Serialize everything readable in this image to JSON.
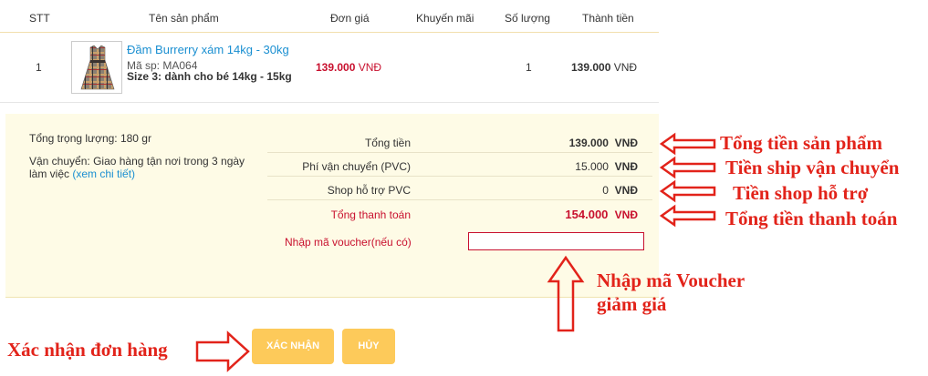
{
  "table": {
    "headers": {
      "stt": "STT",
      "name": "Tên sản phẩm",
      "unit_price": "Đơn giá",
      "promo": "Khuyến mãi",
      "qty": "Số lượng",
      "subtotal": "Thành tiền"
    },
    "rows": [
      {
        "stt": "1",
        "name": "Đầm Burrerry xám 14kg - 30kg",
        "sku": "Mã sp: MA064",
        "size_label": "Size 3:",
        "size_value": "dành cho bé 14kg - 15kg",
        "unit_price": "139.000",
        "currency": "VNĐ",
        "qty": "1",
        "subtotal": "139.000"
      }
    ]
  },
  "summary": {
    "weight": "Tổng trọng lượng: 180 gr",
    "shipping_label": "Vận chuyển:",
    "shipping_text_1": "Giao hàng tận nơi trong 3 ngày",
    "shipping_text_2": "làm việc",
    "shipping_link": "(xem chi tiết)",
    "rows": [
      {
        "label": "Tổng tiền",
        "value": "139.000",
        "currency": "VNĐ"
      },
      {
        "label": "Phí vận chuyển (PVC)",
        "value": "15.000",
        "currency": "VNĐ"
      },
      {
        "label": "Shop hỗ trợ PVC",
        "value": "0",
        "currency": "VNĐ"
      },
      {
        "label": "Tổng thanh toán",
        "value": "154.000",
        "currency": "VNĐ"
      }
    ],
    "voucher_label": "Nhập mã voucher(nếu có)",
    "voucher_value": ""
  },
  "buttons": {
    "confirm": "XÁC NHẬN",
    "cancel": "HỦY"
  },
  "annotations": {
    "total_products": "Tổng tiền sản phẩm",
    "shipping_fee": "Tiền ship vận chuyển",
    "shop_support": "Tiền shop hỗ trợ",
    "grand_total": "Tổng tiền thanh toán",
    "voucher_1": "Nhập mã Voucher",
    "voucher_2": "giảm giá",
    "confirm_order": "Xác nhận đơn hàng"
  },
  "colors": {
    "accent_red": "#e2231a",
    "price_red": "#c8102e",
    "link_blue": "#1a8fd1",
    "button_yellow": "#fdca5a",
    "panel_bg": "#fefbe6"
  }
}
